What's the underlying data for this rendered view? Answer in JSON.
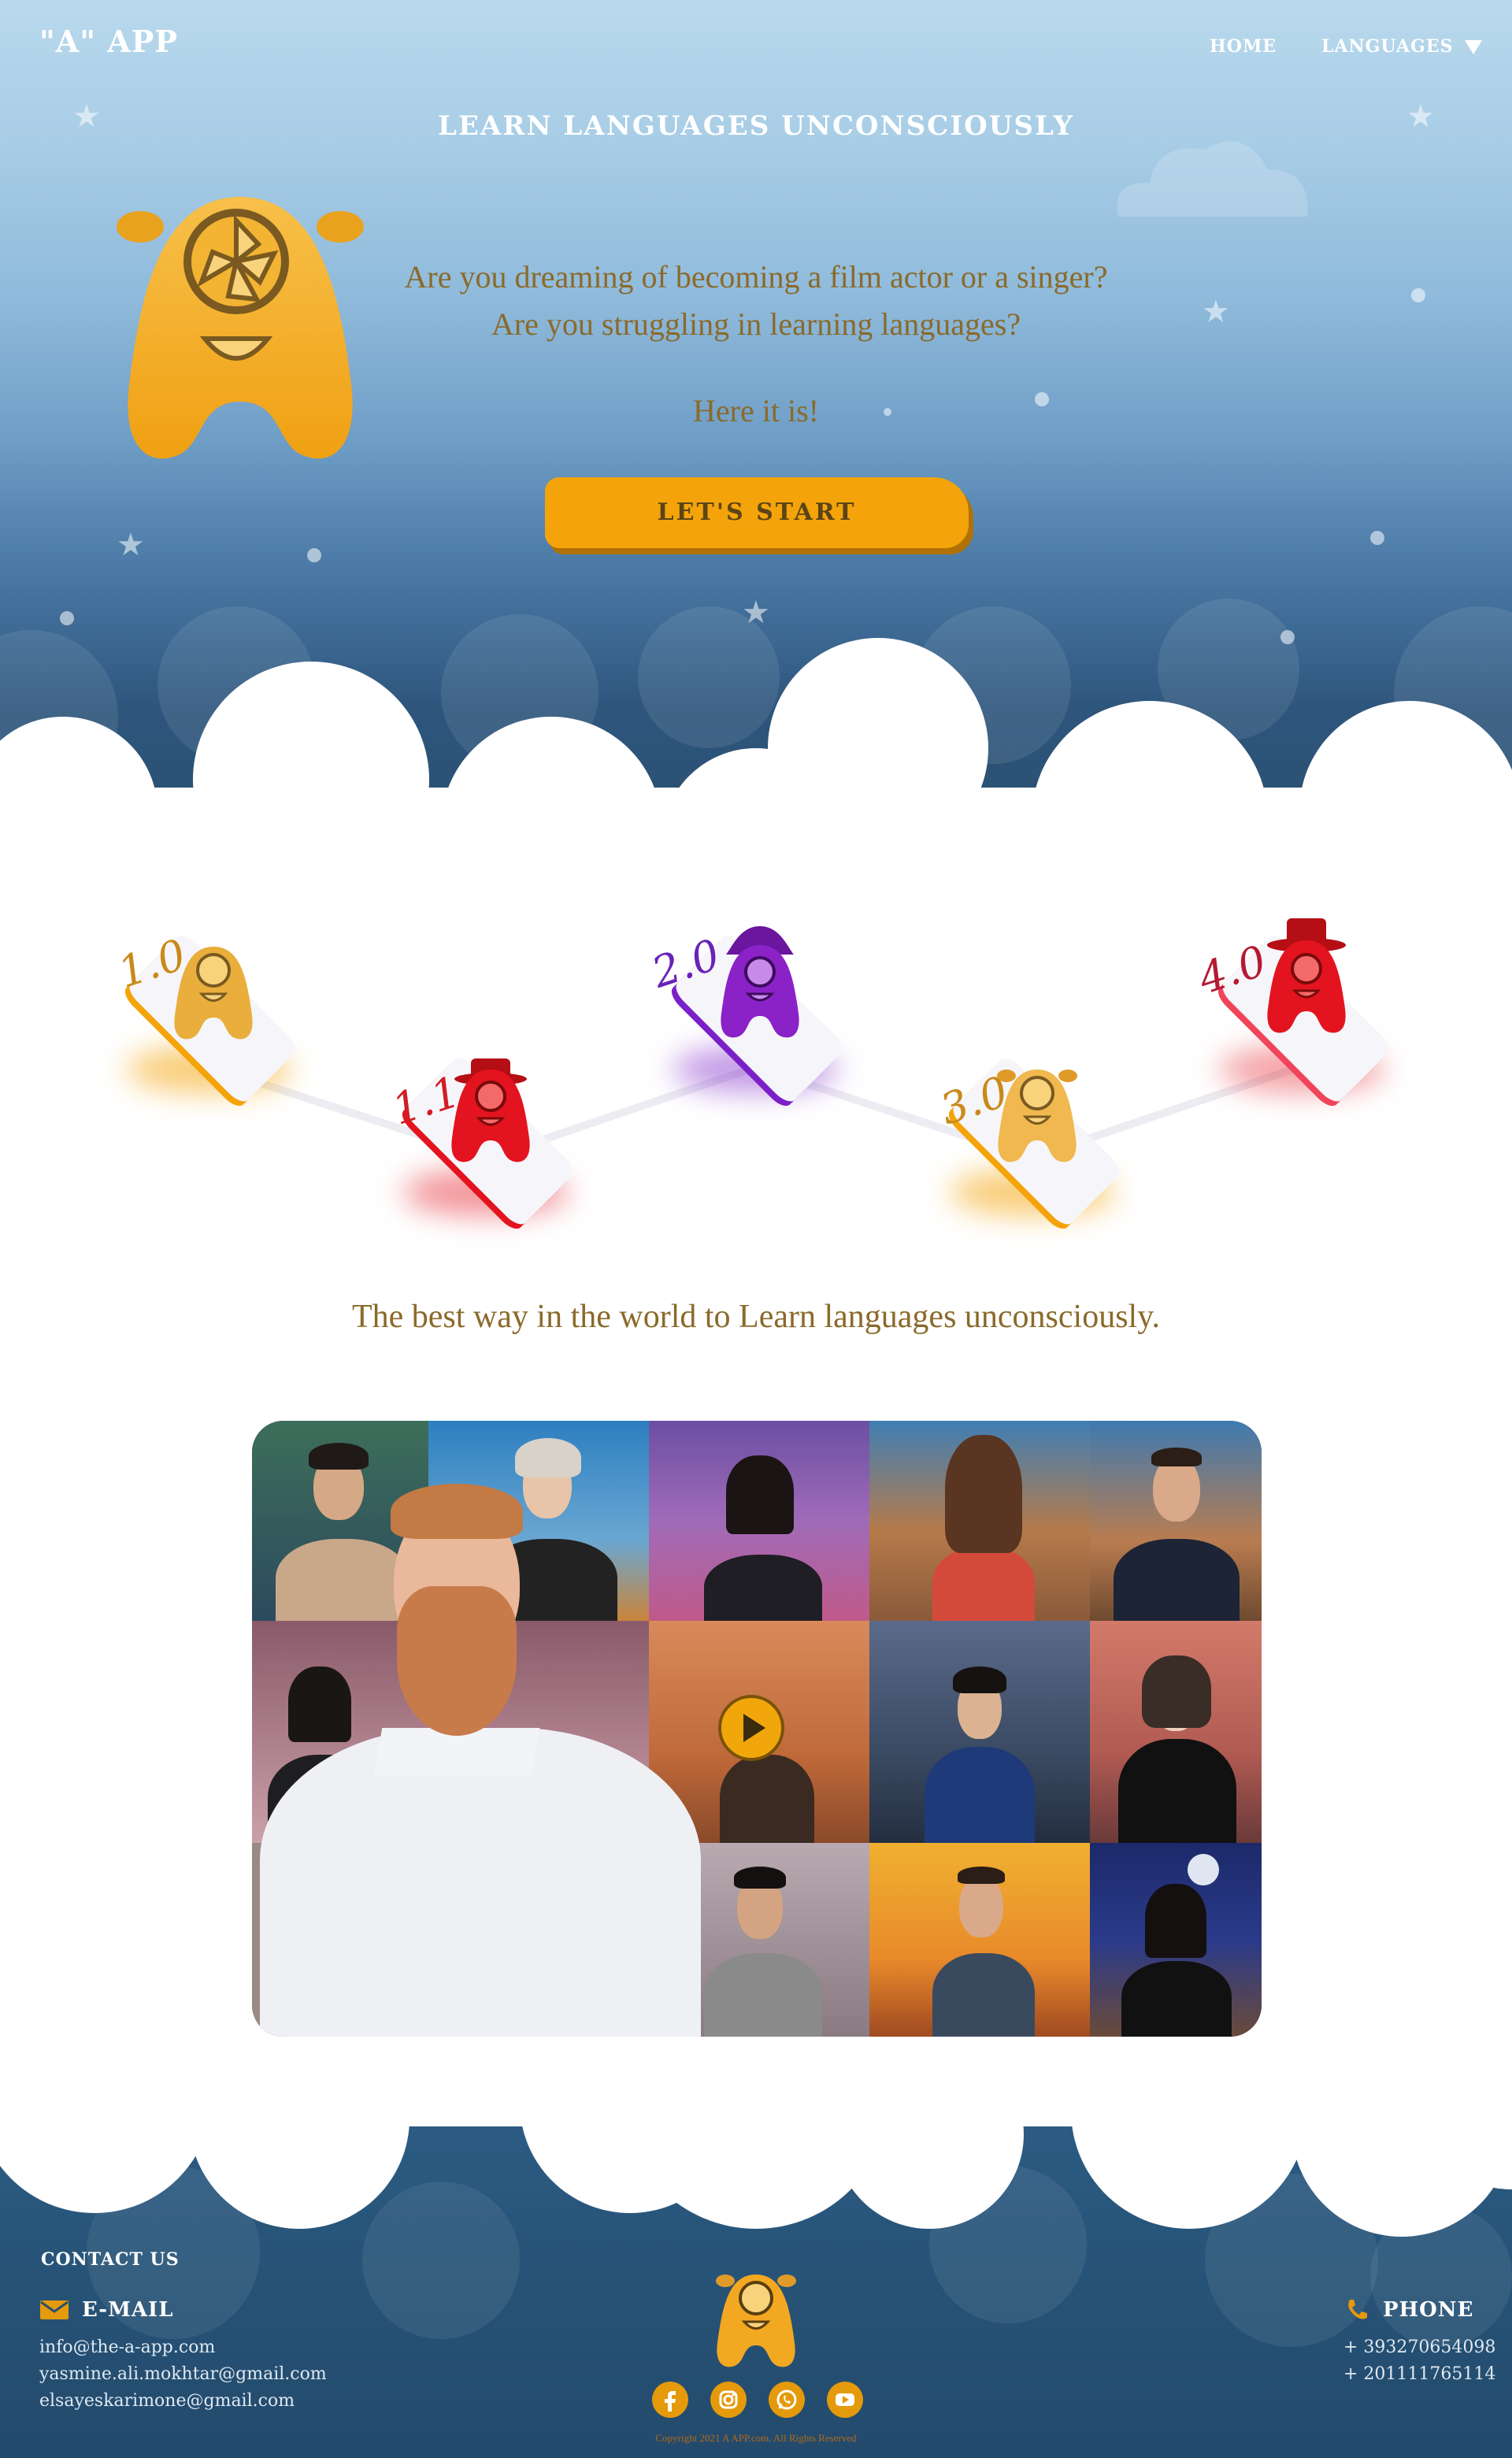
{
  "header": {
    "brand": "\"A\" APP",
    "nav": {
      "home": "HOME",
      "languages": "LANGUAGES"
    }
  },
  "hero": {
    "title": "LEARN LANGUAGES UNCONSCIOUSLY",
    "question_1": "Are you dreaming of becoming a film actor or a singer?",
    "question_2": "Are you struggling in learning languages?",
    "here": "Here it is!",
    "cta": "LET'S START"
  },
  "levels": [
    {
      "label": "1.0",
      "color": "#f4a40a"
    },
    {
      "label": "1.1",
      "color": "#e3141f"
    },
    {
      "label": "2.0",
      "color": "#7b20c8"
    },
    {
      "label": "3.0",
      "color": "#f4a40a"
    },
    {
      "label": "4.0",
      "color": "#e3141f"
    }
  ],
  "tagline": "The best way in the world to Learn languages unconsciously.",
  "footer": {
    "contact_title": "CONTACT US",
    "email_title": "E-MAIL",
    "emails": [
      "info@the-a-app.com",
      "yasmine.ali.mokhtar@gmail.com",
      "elsayeskarimone@gmail.com"
    ],
    "phone_title": "PHONE",
    "phones": [
      "+ 393270654098",
      "+ 201111765114"
    ],
    "copyright": "Copyright 2021 A APP.com. All Rights Reserved"
  },
  "colors": {
    "accent": "#f4a40a",
    "text_brown": "#8a6a2a",
    "sky_top": "#b9d9ec",
    "sky_bottom": "#29506f",
    "footer_bg": "#275478"
  },
  "icons": [
    "languages-chevron-down-icon",
    "mascot-logo",
    "email-icon",
    "phone-icon",
    "facebook-icon",
    "instagram-icon",
    "whatsapp-icon",
    "youtube-icon",
    "play-icon"
  ]
}
